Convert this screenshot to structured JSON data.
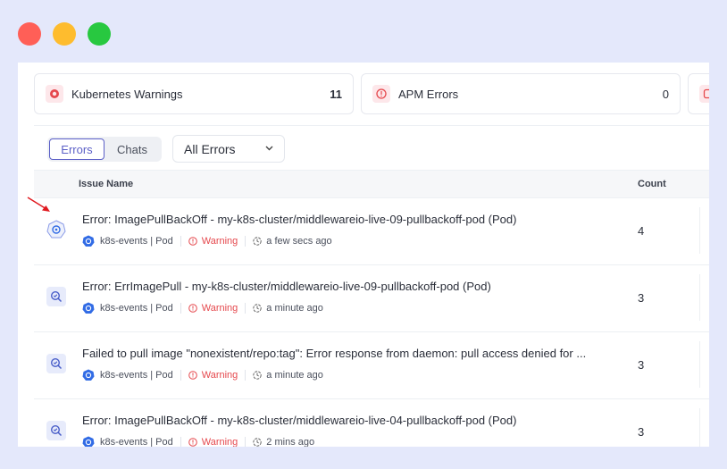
{
  "window": {
    "controls": [
      "close",
      "minimize",
      "maximize"
    ],
    "colors": {
      "close": "#ff5f57",
      "minimize": "#febc2e",
      "maximize": "#28c840"
    }
  },
  "cards": [
    {
      "icon": "k8s-warning-icon",
      "label": "Kubernetes Warnings",
      "count": "11"
    },
    {
      "icon": "apm-error-icon",
      "label": "APM Errors",
      "count": "0"
    },
    {
      "icon": "error-icon"
    }
  ],
  "toolbar": {
    "tabs": [
      "Errors",
      "Chats"
    ],
    "active_tab": "Errors",
    "filter": {
      "value": "All Errors"
    }
  },
  "table": {
    "headers": {
      "name": "Issue Name",
      "count": "Count"
    },
    "rows": [
      {
        "icon": "kubernetes-icon",
        "title": "Error: ImagePullBackOff - my-k8s-cluster/middlewareio-live-09-pullbackoff-pod (Pod)",
        "source": "k8s-events | Pod",
        "severity": "Warning",
        "time": "a few secs ago",
        "count": "4"
      },
      {
        "icon": "search-icon",
        "title": "Error: ErrImagePull - my-k8s-cluster/middlewareio-live-09-pullbackoff-pod (Pod)",
        "source": "k8s-events | Pod",
        "severity": "Warning",
        "time": "a minute ago",
        "count": "3"
      },
      {
        "icon": "search-icon",
        "title": "Failed to pull image \"nonexistent/repo:tag\": Error response from daemon: pull access denied for ...",
        "source": "k8s-events | Pod",
        "severity": "Warning",
        "time": "a minute ago",
        "count": "3"
      },
      {
        "icon": "search-icon",
        "title": "Error: ImagePullBackOff - my-k8s-cluster/middlewareio-live-04-pullbackoff-pod (Pod)",
        "source": "k8s-events | Pod",
        "severity": "Warning",
        "time": "2 mins ago",
        "count": "3"
      }
    ]
  },
  "colors": {
    "accent": "#5b5fc7",
    "warning": "#e5484d",
    "k8s_blue": "#326ce5"
  }
}
